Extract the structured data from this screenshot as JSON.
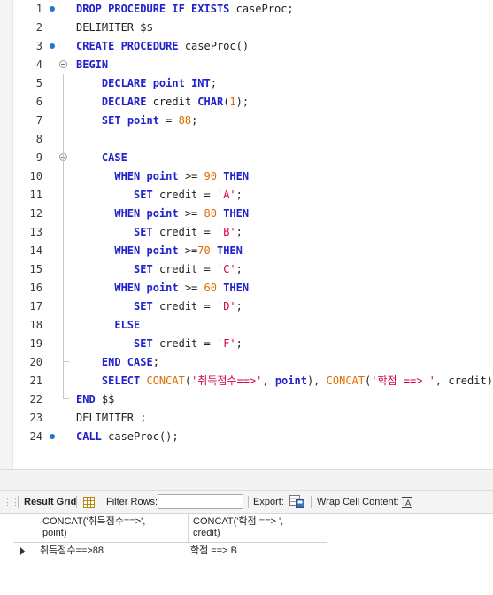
{
  "editor": {
    "lines": [
      {
        "n": "1",
        "dot": true,
        "tokens": [
          [
            "kw",
            "DROP PROCEDURE IF EXISTS "
          ],
          [
            "plain",
            "caseProc;"
          ]
        ]
      },
      {
        "n": "2",
        "tokens": [
          [
            "plain",
            "DELIMITER $$"
          ]
        ]
      },
      {
        "n": "3",
        "dot": true,
        "tokens": [
          [
            "kw",
            "CREATE PROCEDURE "
          ],
          [
            "plain",
            "caseProc()"
          ]
        ]
      },
      {
        "n": "4",
        "fold": true,
        "tokens": [
          [
            "kw",
            "BEGIN"
          ]
        ]
      },
      {
        "n": "5",
        "tokens": [
          [
            "plain",
            "    "
          ],
          [
            "kw",
            "DECLARE "
          ],
          [
            "kw",
            "point "
          ],
          [
            "kw",
            "INT"
          ],
          [
            "plain",
            ";"
          ]
        ]
      },
      {
        "n": "6",
        "tokens": [
          [
            "plain",
            "    "
          ],
          [
            "kw",
            "DECLARE "
          ],
          [
            "plain",
            "credit "
          ],
          [
            "kw",
            "CHAR"
          ],
          [
            "plain",
            "("
          ],
          [
            "num",
            "1"
          ],
          [
            "plain",
            ");"
          ]
        ]
      },
      {
        "n": "7",
        "tokens": [
          [
            "plain",
            "    "
          ],
          [
            "kw",
            "SET "
          ],
          [
            "kw",
            "point"
          ],
          [
            "plain",
            " = "
          ],
          [
            "num",
            "88"
          ],
          [
            "plain",
            ";"
          ]
        ]
      },
      {
        "n": "8",
        "tokens": []
      },
      {
        "n": "9",
        "fold": true,
        "tokens": [
          [
            "plain",
            "    "
          ],
          [
            "kw",
            "CASE"
          ]
        ]
      },
      {
        "n": "10",
        "tokens": [
          [
            "plain",
            "      "
          ],
          [
            "kw",
            "WHEN "
          ],
          [
            "kw",
            "point"
          ],
          [
            "plain",
            " >= "
          ],
          [
            "num",
            "90"
          ],
          [
            "kw",
            " THEN"
          ]
        ]
      },
      {
        "n": "11",
        "tokens": [
          [
            "plain",
            "         "
          ],
          [
            "kw",
            "SET "
          ],
          [
            "plain",
            "credit = "
          ],
          [
            "str",
            "'A'"
          ],
          [
            "plain",
            ";"
          ]
        ]
      },
      {
        "n": "12",
        "tokens": [
          [
            "plain",
            "      "
          ],
          [
            "kw",
            "WHEN "
          ],
          [
            "kw",
            "point"
          ],
          [
            "plain",
            " >= "
          ],
          [
            "num",
            "80"
          ],
          [
            "kw",
            " THEN"
          ]
        ]
      },
      {
        "n": "13",
        "tokens": [
          [
            "plain",
            "         "
          ],
          [
            "kw",
            "SET "
          ],
          [
            "plain",
            "credit = "
          ],
          [
            "str",
            "'B'"
          ],
          [
            "plain",
            ";"
          ]
        ]
      },
      {
        "n": "14",
        "tokens": [
          [
            "plain",
            "      "
          ],
          [
            "kw",
            "WHEN "
          ],
          [
            "kw",
            "point"
          ],
          [
            "plain",
            " >="
          ],
          [
            "num",
            "70"
          ],
          [
            "kw",
            " THEN"
          ]
        ]
      },
      {
        "n": "15",
        "tokens": [
          [
            "plain",
            "         "
          ],
          [
            "kw",
            "SET "
          ],
          [
            "plain",
            "credit = "
          ],
          [
            "str",
            "'C'"
          ],
          [
            "plain",
            ";"
          ]
        ]
      },
      {
        "n": "16",
        "tokens": [
          [
            "plain",
            "      "
          ],
          [
            "kw",
            "WHEN "
          ],
          [
            "kw",
            "point"
          ],
          [
            "plain",
            " >= "
          ],
          [
            "num",
            "60"
          ],
          [
            "kw",
            " THEN"
          ]
        ]
      },
      {
        "n": "17",
        "tokens": [
          [
            "plain",
            "         "
          ],
          [
            "kw",
            "SET "
          ],
          [
            "plain",
            "credit = "
          ],
          [
            "str",
            "'D'"
          ],
          [
            "plain",
            ";"
          ]
        ]
      },
      {
        "n": "18",
        "tokens": [
          [
            "plain",
            "      "
          ],
          [
            "kw",
            "ELSE"
          ]
        ]
      },
      {
        "n": "19",
        "tokens": [
          [
            "plain",
            "         "
          ],
          [
            "kw",
            "SET "
          ],
          [
            "plain",
            "credit = "
          ],
          [
            "str",
            "'F'"
          ],
          [
            "plain",
            ";"
          ]
        ]
      },
      {
        "n": "20",
        "tokens": [
          [
            "plain",
            "    "
          ],
          [
            "kw",
            "END CASE"
          ],
          [
            "plain",
            ";"
          ]
        ]
      },
      {
        "n": "21",
        "tokens": [
          [
            "plain",
            "    "
          ],
          [
            "kw",
            "SELECT "
          ],
          [
            "num",
            "CONCAT"
          ],
          [
            "plain",
            "("
          ],
          [
            "str",
            "'취득점수==>'"
          ],
          [
            "plain",
            ", "
          ],
          [
            "kw",
            "point"
          ],
          [
            "plain",
            "), "
          ],
          [
            "num",
            "CONCAT"
          ],
          [
            "plain",
            "("
          ],
          [
            "str",
            "'학점 ==> '"
          ],
          [
            "plain",
            ", credit);"
          ]
        ]
      },
      {
        "n": "22",
        "tokens": [
          [
            "kw",
            "END "
          ],
          [
            "plain",
            "$$"
          ]
        ]
      },
      {
        "n": "23",
        "tokens": [
          [
            "plain",
            "DELIMITER ;"
          ]
        ]
      },
      {
        "n": "24",
        "dot": true,
        "tokens": [
          [
            "kw",
            "CALL "
          ],
          [
            "plain",
            "caseProc();"
          ]
        ]
      }
    ]
  },
  "result_toolbar": {
    "result_grid_label": "Result Grid",
    "filter_rows_label": "Filter Rows:",
    "filter_value": "",
    "export_label": "Export:",
    "wrap_label": "Wrap Cell Content:"
  },
  "result_grid": {
    "columns": [
      "CONCAT('취득점수==>',\npoint)",
      "CONCAT('학점 ==> ',\ncredit)"
    ],
    "rows": [
      [
        "취득점수==>88",
        "학점 ==> B"
      ]
    ]
  },
  "colors": {
    "keyword": "#2222cc",
    "number": "#e06c00",
    "string": "#d0004a",
    "breakpoint": "#1f74d8"
  }
}
